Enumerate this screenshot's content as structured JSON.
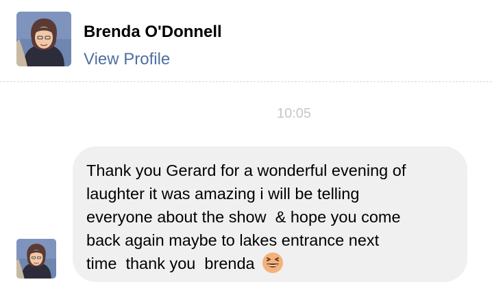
{
  "contact": {
    "name": "Brenda O'Donnell",
    "view_profile_label": "View Profile"
  },
  "conversation": {
    "timestamp": "10:05",
    "message": {
      "lines": [
        "Thank you Gerard for a wonderful evening of",
        "laughter it was amazing i will be telling",
        "everyone about the show  & hope you come",
        "back again maybe to lakes entrance next",
        "time  thank you  brenda"
      ],
      "emoji": "grinning-squinting-face-icon"
    }
  },
  "colors": {
    "link": "#4f6ea0",
    "bubble_background": "#f1f0f0",
    "timestamp": "#c6c6c6",
    "emoji_face": "#f3b27a"
  }
}
